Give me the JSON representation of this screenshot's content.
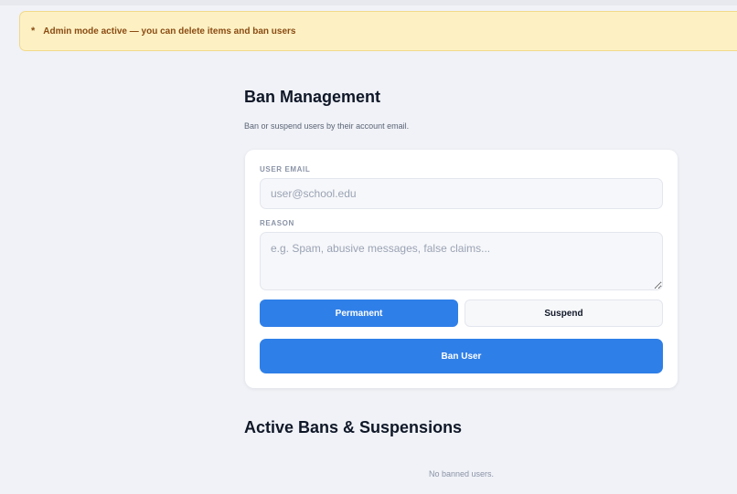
{
  "banner": {
    "icon": "asterisk-icon",
    "icon_glyph": "*",
    "text": "Admin mode active — you can delete items and ban users",
    "color": "#8a4b12",
    "background": "#fdf1c4"
  },
  "header": {
    "title": "Ban Management",
    "subtitle": "Ban or suspend users by their account email."
  },
  "form": {
    "email_label": "USER EMAIL",
    "email_value": "",
    "email_placeholder": "user@school.edu",
    "reason_label": "REASON",
    "reason_value": "",
    "reason_placeholder": "e.g. Spam, abusive messages, false claims...",
    "mode_options": [
      "Permanent",
      "Suspend"
    ],
    "selected_mode": "Permanent",
    "submit_label": "Ban User",
    "accent_color": "#2f7fe8"
  },
  "active_bans": {
    "title": "Active Bans & Suspensions",
    "empty_text": "No banned users.",
    "items": []
  }
}
